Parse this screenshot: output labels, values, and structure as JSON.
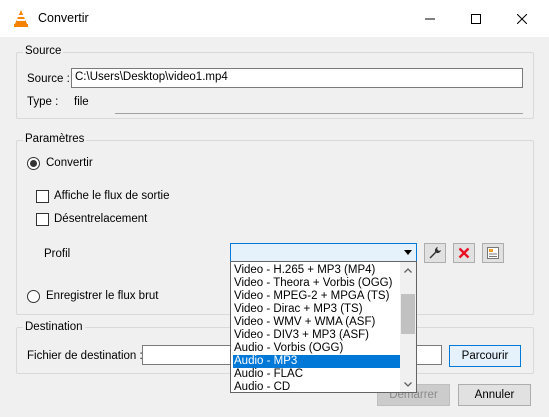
{
  "window": {
    "title": "Convertir",
    "controls": {
      "minimize": "minimize-icon",
      "maximize": "maximize-icon",
      "close": "close-icon"
    }
  },
  "source": {
    "group_label": "Source",
    "source_label": "Source :",
    "source_value": "C:\\Users\\Desktop\\video1.mp4",
    "type_label": "Type :",
    "type_value": "file"
  },
  "parametres": {
    "group_label": "Paramètres",
    "convertir_label": "Convertir",
    "affiche_label": "Affiche le flux de sortie",
    "desentrelacement_label": "Désentrelacement",
    "profil_label": "Profil",
    "enregistrer_label": "Enregistrer le flux brut"
  },
  "profile_dropdown": {
    "selected": "Audio - MP3",
    "options": [
      "Video - H.265 + MP3 (MP4)",
      "Video - Theora + Vorbis (OGG)",
      "Video - MPEG-2 + MPGA (TS)",
      "Video - Dirac + MP3 (TS)",
      "Video - WMV + WMA (ASF)",
      "Video - DIV3 + MP3 (ASF)",
      "Audio - Vorbis (OGG)",
      "Audio - MP3",
      "Audio - FLAC",
      "Audio - CD"
    ]
  },
  "destination": {
    "group_label": "Destination",
    "file_label": "Fichier de destination :",
    "file_value": "",
    "browse_label": "Parcourir"
  },
  "footer": {
    "start_label": "Démarrer",
    "cancel_label": "Annuler"
  },
  "colors": {
    "accent": "#0078d7",
    "vlc_orange": "#f58200",
    "delete_red": "#e81123"
  }
}
